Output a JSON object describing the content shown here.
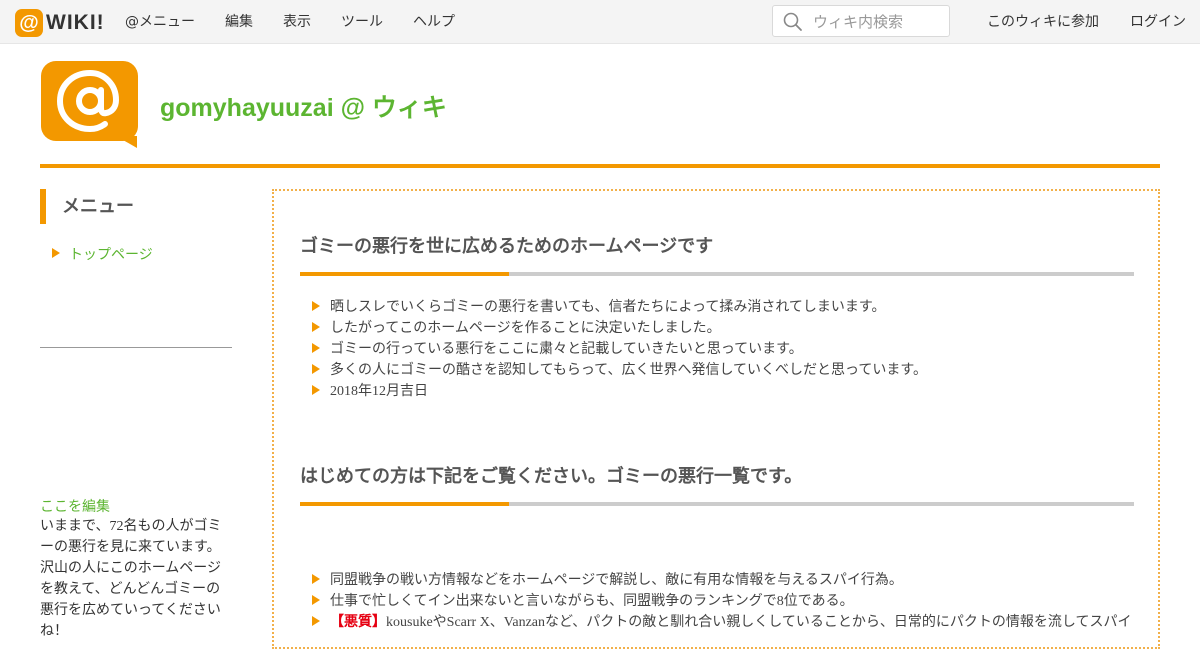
{
  "topbar": {
    "logo_text": "WIKI!",
    "menu": [
      "@メニュー",
      "編集",
      "表示",
      "ツール",
      "ヘルプ"
    ],
    "search_placeholder": "ウィキ内検索",
    "join_label": "このウィキに参加",
    "login_label": "ログイン"
  },
  "site": {
    "title": "gomyhayuuzai @ ウィキ"
  },
  "sidebar": {
    "menu_heading": "メニュー",
    "items": [
      {
        "label": "トップページ"
      }
    ],
    "edit_link": "ここを編集",
    "text": "いままで、72名もの人がゴミーの悪行を見に来ています。沢山の人にこのホームページを教えて、どんどんゴミーの悪行を広めていってくださいね！"
  },
  "main": {
    "section1": {
      "heading": "ゴミーの悪行を世に広めるためのホームページです",
      "items": [
        "晒しスレでいくらゴミーの悪行を書いても、信者たちによって揉み消されてしまいます。",
        "したがってこのホームページを作ることに決定いたしました。",
        "ゴミーの行っている悪行をここに粛々と記載していきたいと思っています。",
        "多くの人にゴミーの酷さを認知してもらって、広く世界へ発信していくべしだと思っています。",
        "2018年12月吉日"
      ]
    },
    "section2": {
      "heading": "はじめての方は下記をご覧ください。ゴミーの悪行一覧です。",
      "items": [
        "同盟戦争の戦い方情報などをホームページで解説し、敵に有用な情報を与えるスパイ行為。",
        "仕事で忙しくてイン出来ないと言いながらも、同盟戦争のランキングで8位である。"
      ],
      "item3_tag": "【悪質】",
      "item3_text": "kousukeやScarr X、Vanzanなど、パクトの敵と馴れ合い親しくしていることから、日常的にパクトの情報を流してスパイ"
    }
  },
  "colors": {
    "accent_orange": "#f39800",
    "link_green": "#5cb531",
    "danger_red": "#e60012"
  }
}
